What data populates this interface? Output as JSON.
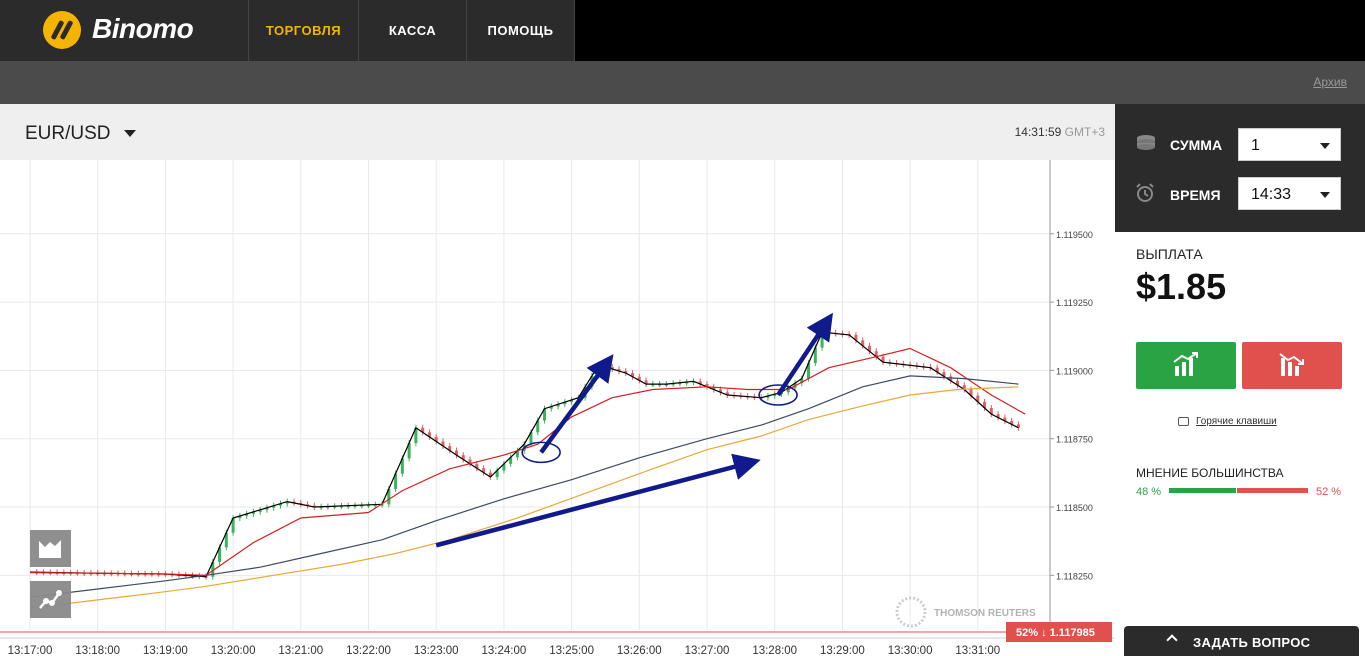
{
  "brand": {
    "name": "Binomo"
  },
  "nav": {
    "items": [
      {
        "label": "ТОРГОВЛЯ",
        "active": true
      },
      {
        "label": "КАССА",
        "active": false
      },
      {
        "label": "ПОМОЩЬ",
        "active": false
      }
    ]
  },
  "subbar": {
    "archive_link": "Архив"
  },
  "chart_header": {
    "pair": "EUR/USD",
    "time": "14:31:59",
    "timezone": "GMT+3"
  },
  "panel": {
    "amount_label": "СУММА",
    "amount_value": "1",
    "time_label": "ВРЕМЯ",
    "time_value": "14:33",
    "payout_label": "ВЫПЛАТА",
    "payout_value": "$1.85",
    "hotkeys": "Горячие клавиши",
    "opinion_label": "МНЕНИЕ БОЛЬШИНСТВА",
    "opinion_up": "48 %",
    "opinion_down": "52 %",
    "ask_button": "ЗАДАТЬ ВОПРОС"
  },
  "colors": {
    "accent": "#f2b600",
    "up": "#2aa345",
    "down": "#e0504d",
    "dark": "#2b2b2b"
  },
  "chart_data": {
    "type": "line",
    "title": "",
    "watermark": "THOMSON REUTERS",
    "x_ticks": [
      "13:17:00",
      "13:18:00",
      "13:19:00",
      "13:20:00",
      "13:21:00",
      "13:22:00",
      "13:23:00",
      "13:24:00",
      "13:25:00",
      "13:26:00",
      "13:27:00",
      "13:28:00",
      "13:29:00",
      "13:30:00",
      "13:31:00"
    ],
    "x_range": [
      "13:17:00",
      "13:31:40"
    ],
    "y_ticks": [
      "1.118250",
      "1.118500",
      "1.118750",
      "1.119000",
      "1.119250",
      "1.119500"
    ],
    "y_range": [
      1.11805,
      1.11977
    ],
    "current_price_label": "1.117985",
    "current_price_pct": "52% ↓",
    "series": [
      {
        "color": "#000000",
        "x": [
          0,
          1,
          2,
          2.6,
          3,
          3.4,
          3.8,
          4.2,
          5.2,
          5.7,
          6.3,
          6.8,
          7.3,
          7.6,
          8.1,
          8.4,
          8.8,
          9.1,
          9.4,
          9.8,
          10.3,
          10.8,
          11.1,
          11.4,
          11.7,
          12.1,
          12.6,
          13.3,
          13.8,
          14.2,
          14.6
        ],
        "y": [
          1.118262,
          1.118258,
          1.118255,
          1.118245,
          1.11846,
          1.11849,
          1.11852,
          1.1185,
          1.11851,
          1.11879,
          1.11869,
          1.11861,
          1.11873,
          1.11886,
          1.1189,
          1.11902,
          1.11899,
          1.11895,
          1.11895,
          1.11896,
          1.11891,
          1.1189,
          1.11892,
          1.11897,
          1.11914,
          1.11913,
          1.11903,
          1.11901,
          1.11893,
          1.11884,
          1.11879
        ]
      },
      {
        "color": "#d42020",
        "x": [
          0,
          1,
          2,
          2.6,
          3.3,
          4,
          5,
          5.5,
          6.2,
          7,
          7.5,
          8,
          8.6,
          9.2,
          10,
          10.6,
          11.2,
          11.8,
          12.5,
          13,
          13.6,
          14.2,
          14.7
        ],
        "y": [
          1.11826,
          1.118258,
          1.118255,
          1.11825,
          1.11837,
          1.11846,
          1.11848,
          1.11856,
          1.11864,
          1.11869,
          1.11873,
          1.11883,
          1.1189,
          1.11893,
          1.11894,
          1.11893,
          1.11893,
          1.11901,
          1.11905,
          1.11908,
          1.11901,
          1.11891,
          1.11884
        ]
      },
      {
        "color": "#3b4a66",
        "x": [
          0,
          1,
          2,
          2.6,
          3.4,
          4.3,
          5.2,
          6,
          7,
          8,
          9,
          10,
          10.8,
          11.5,
          12.3,
          13,
          13.8,
          14.6
        ],
        "y": [
          1.11817,
          1.1182,
          1.11823,
          1.11825,
          1.11828,
          1.11833,
          1.11838,
          1.11845,
          1.11853,
          1.1186,
          1.11868,
          1.11875,
          1.1188,
          1.11886,
          1.11894,
          1.11898,
          1.11897,
          1.11895
        ]
      },
      {
        "color": "#e8a83a",
        "x": [
          0,
          1,
          2,
          2.6,
          3.6,
          4.6,
          5.4,
          6.2,
          7.2,
          8.2,
          9.2,
          10,
          10.8,
          11.5,
          12.3,
          13,
          13.7,
          14.6
        ],
        "y": [
          1.11813,
          1.11816,
          1.11819,
          1.11821,
          1.11825,
          1.11829,
          1.11833,
          1.11838,
          1.11846,
          1.11855,
          1.11864,
          1.11871,
          1.11876,
          1.11882,
          1.11887,
          1.11891,
          1.11893,
          1.11894
        ]
      }
    ],
    "annotations": [
      {
        "type": "ellipse",
        "at": [
          7.55,
          1.1187
        ]
      },
      {
        "type": "ellipse",
        "at": [
          11.05,
          1.11891
        ]
      },
      {
        "type": "arrow",
        "from": [
          7.55,
          1.1187
        ],
        "to": [
          8.5,
          1.11902
        ]
      },
      {
        "type": "arrow",
        "from": [
          11.05,
          1.11891
        ],
        "to": [
          11.75,
          1.11917
        ]
      },
      {
        "type": "arrow",
        "from": [
          6,
          1.11836
        ],
        "to": [
          10.6,
          1.11866
        ]
      }
    ]
  }
}
